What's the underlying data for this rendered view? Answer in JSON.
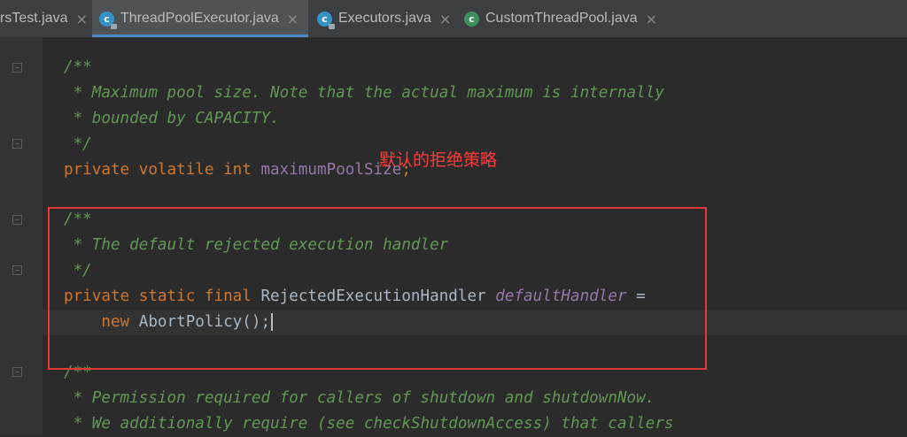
{
  "tabs": [
    {
      "label": "rsTest.java",
      "icon": "java-class-icon",
      "active": false
    },
    {
      "label": "ThreadPoolExecutor.java",
      "icon": "java-class-locked-icon",
      "active": true
    },
    {
      "label": "Executors.java",
      "icon": "java-class-locked-icon",
      "active": false
    },
    {
      "label": "CustomThreadPool.java",
      "icon": "java-class-runnable-icon",
      "active": false
    }
  ],
  "tab_close_glyph": "×",
  "code": {
    "c1_open": "/**",
    "c1_l1": " * Maximum pool size. Note that the actual maximum is internally",
    "c1_l2": " * bounded by CAPACITY.",
    "c1_close": " */",
    "decl1_kw": "private volatile int ",
    "decl1_field": "maximumPoolSize",
    "decl1_end": ";",
    "c2_open": "/**",
    "c2_l1": " * The default rejected execution handler",
    "c2_close": " */",
    "decl2_kw": "private static final ",
    "decl2_type": "RejectedExecutionHandler ",
    "decl2_field": "defaultHandler",
    "decl2_eq": " =",
    "decl3_indent": "    ",
    "decl3_kw": "new ",
    "decl3_rest": "AbortPolicy();",
    "c3_open": "/**",
    "c3_l1": " * Permission required for callers of shutdown and shutdownNow.",
    "c3_l2": " * We additionally require (see checkShutdownAccess) that callers"
  },
  "annotation": {
    "text": "默认的拒绝策略",
    "color": "#e53935"
  }
}
